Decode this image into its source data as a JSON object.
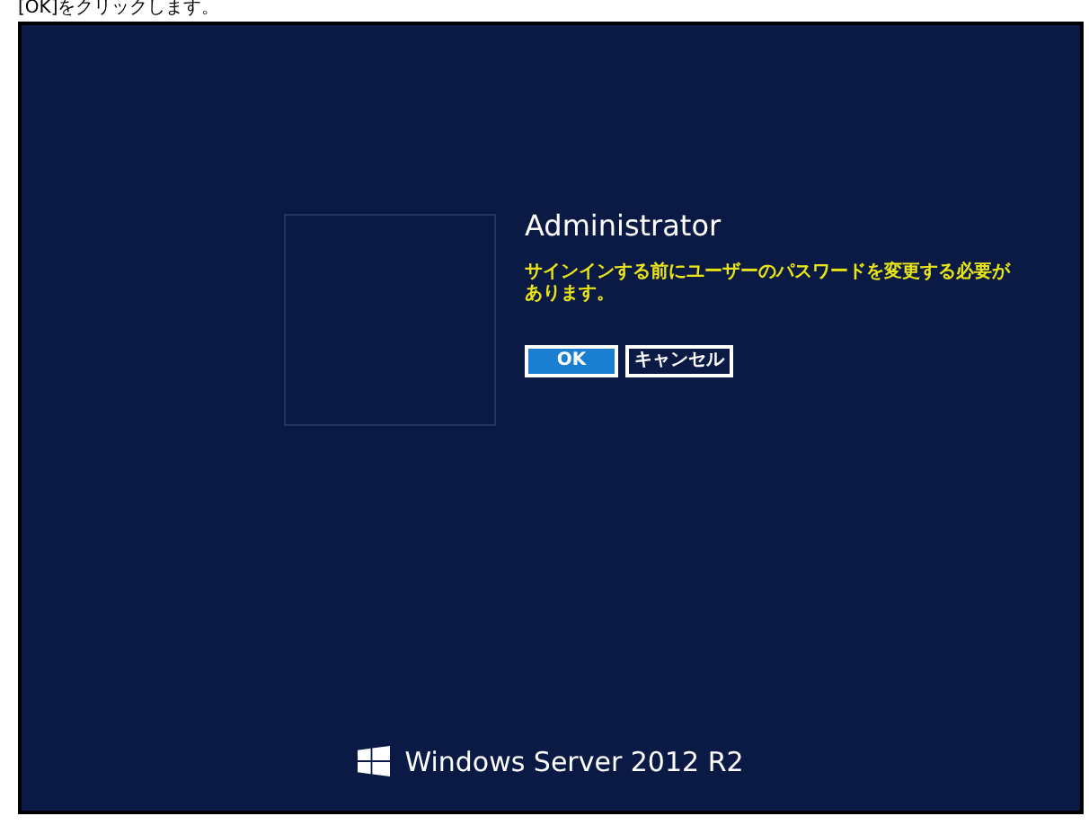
{
  "caption": "[OK]をクリックします。",
  "screen": {
    "user_name": "Administrator",
    "message": "サインインする前にユーザーのパスワードを変更する必要があります。",
    "buttons": [
      {
        "label": "OK",
        "kind": "primary"
      },
      {
        "label": "キャンセル",
        "kind": "secondary"
      }
    ],
    "brand": "Windows Server 2012 R2"
  }
}
